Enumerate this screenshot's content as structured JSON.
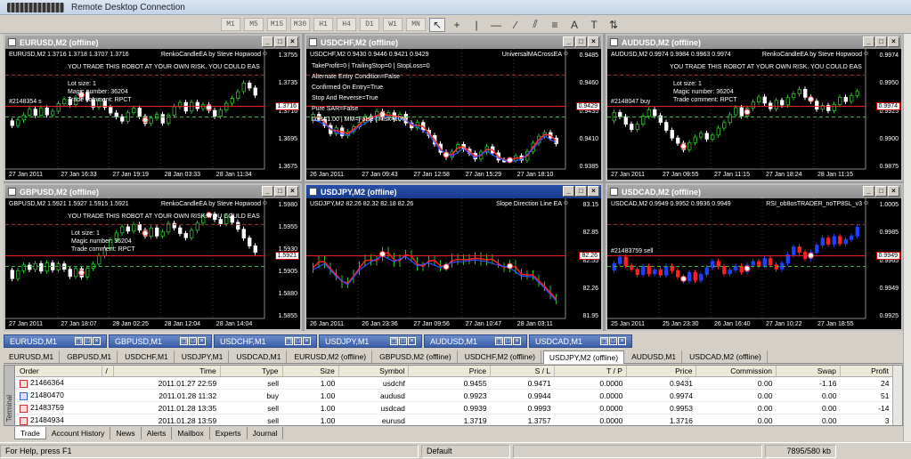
{
  "window": {
    "title": "Remote Desktop Connection"
  },
  "toolbar": {
    "timeframes": [
      "M1",
      "M5",
      "M15",
      "M30",
      "H1",
      "H4",
      "D1",
      "W1",
      "MN"
    ]
  },
  "charts": [
    {
      "title": "EURUSD,M2 (offline)",
      "quote": "EURUSD,M2  1.3716 1.3718 1.3707 1.3716",
      "ea": "RenkoCandleEA by Steve Hopwood",
      "warn": "YOU TRADE THIS ROBOT AT YOUR OWN RISK. YOU COULD EAS",
      "info": [
        "Lot size: 1",
        "Magic number: 36204",
        "Trade comment: RPCT"
      ],
      "trade": "#2148354 s",
      "price": "1.3716",
      "yticks": [
        "1.3755",
        "1.3735",
        "1.3716",
        "1.3695",
        "1.3675"
      ],
      "xticks": [
        "27 Jan 2011",
        "27 Jan 16:33",
        "27 Jan 19:19",
        "28 Jan 03:33",
        "28 Jan 11:34"
      ]
    },
    {
      "title": "USDCHF,M2 (offline)",
      "quote": "USDCHF,M2  0.9430 0.9446 0.9421 0.9429",
      "ea": "UniversalMACrossEA",
      "info": [
        "TakeProfit=0  |  TrailingStop=0  |  StopLoss=0",
        "Alternate Entry Condition=False",
        "Confirmed On Entry=True",
        "Stop And Reverse=True",
        "Pure SAR=False",
        "Lots=1.00  |  MM=False  |  Risk=10%"
      ],
      "price": "0.9429",
      "yticks": [
        "0.9485",
        "0.9460",
        "0.9435",
        "0.9410",
        "0.9385"
      ],
      "xticks": [
        "26 Jan 2011",
        "27 Jan 09:43",
        "27 Jan 12:58",
        "27 Jan 15:29",
        "27 Jan 18:10"
      ]
    },
    {
      "title": "AUDUSD,M2 (offline)",
      "quote": "AUDUSD,M2  0.9974 0.9984 0.9963 0.9974",
      "ea": "RenkoCandleEA by Steve Hopwood",
      "warn": "YOU TRADE THIS ROBOT AT YOUR OWN RISK. YOU COULD EAS",
      "info": [
        "Lot size: 1",
        "Magic number: 36204",
        "Trade comment: RPCT"
      ],
      "trade": "#2148047 buy",
      "price": "0.9974",
      "yticks": [
        "0.9974",
        "0.9950",
        "0.9925",
        "0.9900",
        "0.9875"
      ],
      "xticks": [
        "27 Jan 2011",
        "27 Jan 09:55",
        "27 Jan 11:15",
        "27 Jan 18:24",
        "28 Jan 11:15"
      ]
    },
    {
      "title": "GBPUSD,M2 (offline)",
      "quote": "GBPUSD,M2  1.5921 1.5927 1.5915 1.5921",
      "ea": "RenkoCandleEA by Steve Hopwood",
      "warn": "YOU TRADE THIS ROBOT AT YOUR OWN RISK. YOU COULD EAS",
      "info": [
        "Lot size: 1",
        "Magic number: 36204",
        "Trade comment: RPCT"
      ],
      "price": "1.5921",
      "yticks": [
        "1.5980",
        "1.5955",
        "1.5930",
        "1.5905",
        "1.5880",
        "1.5855"
      ],
      "xticks": [
        "27 Jan 2011",
        "27 Jan 18:07",
        "28 Jan 02:25",
        "28 Jan 12:04",
        "28 Jan 14:04"
      ]
    },
    {
      "title": "USDJPY,M2 (offline)",
      "quote": "USDJPY,M2  82.26 82.32 82.18 82.26",
      "ea": "Slope Direction Line EA",
      "price": "82.26",
      "yticks": [
        "83.15",
        "82.85",
        "82.55",
        "82.26",
        "81.95"
      ],
      "xticks": [
        "26 Jan 2011",
        "26 Jan 23:36",
        "27 Jan 09:56",
        "27 Jan 10:47",
        "28 Jan 03:11"
      ]
    },
    {
      "title": "USDCAD,M2 (offline)",
      "quote": "USDCAD,M2  0.9949 0.9952 0.9936 0.9949",
      "ea": "RSI_ob8osTRADER_noTP8SL_v3",
      "trade": "#21483759 sell",
      "price": "0.9949",
      "yticks": [
        "1.0005",
        "0.9985",
        "0.9965",
        "0.9949",
        "0.9925"
      ],
      "xticks": [
        "25 Jan 2011",
        "25 Jan 23:30",
        "26 Jan 16:40",
        "27 Jan 10:22",
        "27 Jan 18:55"
      ]
    }
  ],
  "minimized_windows": [
    "EURUSD,M1",
    "GBPUSD,M1",
    "USDCHF,M1",
    "USDJPY,M1",
    "AUDUSD,M1",
    "USDCAD,M1"
  ],
  "chart_tabs": [
    "EURUSD,M1",
    "GBPUSD,M1",
    "USDCHF,M1",
    "USDJPY,M1",
    "USDCAD,M1",
    "EURUSD,M2 (offline)",
    "GBPUSD,M2 (offline)",
    "USDCHF,M2 (offline)",
    "USDJPY,M2 (offline)",
    "AUDUSD,M1",
    "USDCAD,M2 (offline)"
  ],
  "active_chart_tab": "USDJPY,M2 (offline)",
  "terminal": {
    "side_label": "Terminal",
    "columns": [
      "Order",
      "/",
      "Time",
      "Type",
      "Size",
      "Symbol",
      "Price",
      "S / L",
      "T / P",
      "Price",
      "Commission",
      "Swap",
      "Profit"
    ],
    "rows": [
      [
        "21466364",
        "2011.01.27 22:59",
        "sell",
        "1.00",
        "usdchf",
        "0.9455",
        "0.9471",
        "0.0000",
        "0.9431",
        "0.00",
        "-1.16",
        "24"
      ],
      [
        "21480470",
        "2011.01.28 11:32",
        "buy",
        "1.00",
        "audusd",
        "0.9923",
        "0.9944",
        "0.0000",
        "0.9974",
        "0.00",
        "0.00",
        "51"
      ],
      [
        "21483759",
        "2011.01.28 13:35",
        "sell",
        "1.00",
        "usdcad",
        "0.9939",
        "0.9993",
        "0.0000",
        "0.9953",
        "0.00",
        "0.00",
        "-14"
      ],
      [
        "21484934",
        "2011.01.28 13:59",
        "sell",
        "1.00",
        "eurusd",
        "1.3719",
        "1.3757",
        "0.0000",
        "1.3716",
        "0.00",
        "0.00",
        "3"
      ]
    ],
    "tabs": [
      "Trade",
      "Account History",
      "News",
      "Alerts",
      "Mailbox",
      "Experts",
      "Journal"
    ]
  },
  "status": {
    "help": "For Help, press F1",
    "profile": "Default",
    "traffic": "7895/580 kb"
  },
  "colors": {
    "bull": "#2bc12b",
    "bear": "#ffffff",
    "grid": "#606060",
    "buy_line": "#3ab53a",
    "sell_line": "#ff2020"
  }
}
